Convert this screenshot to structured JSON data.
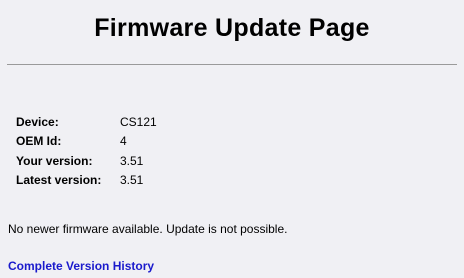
{
  "page": {
    "title": "Firmware Update Page"
  },
  "info": {
    "rows": [
      {
        "label": "Device:",
        "value": "CS121"
      },
      {
        "label": "OEM Id:",
        "value": "4"
      },
      {
        "label": "Your version:",
        "value": "3.51"
      },
      {
        "label": "Latest version:",
        "value": "3.51"
      }
    ]
  },
  "status": {
    "message": "No newer firmware available. Update is not possible."
  },
  "links": {
    "history_label": "Complete Version History",
    "history_color": "#1a1acc"
  }
}
